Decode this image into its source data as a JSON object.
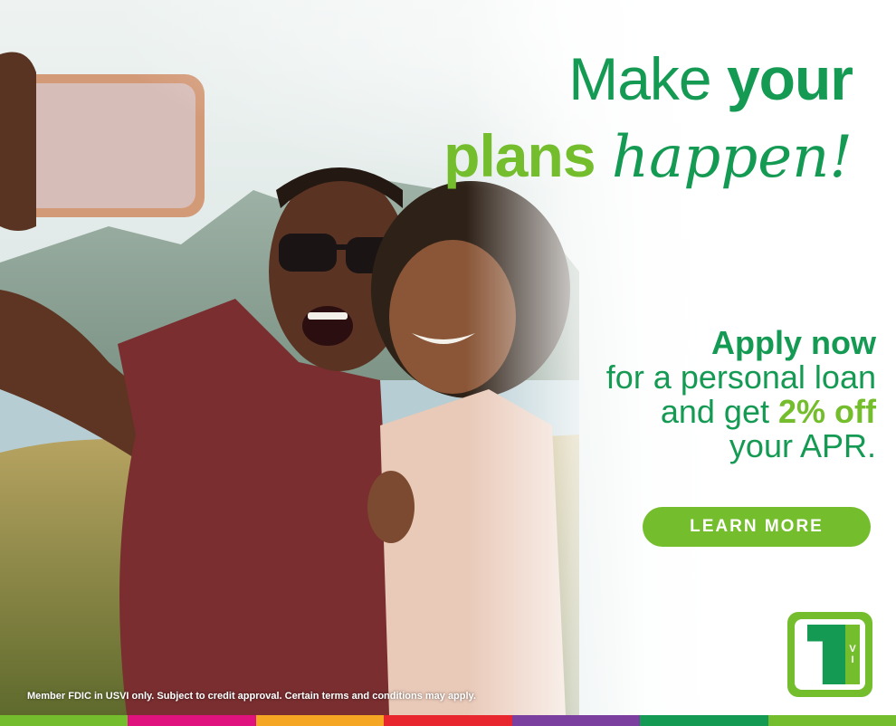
{
  "headline": {
    "make": "Make",
    "your": "your",
    "plans": "plans",
    "happen": "happen!"
  },
  "offer": {
    "apply": "Apply now",
    "line2": "for a personal loan",
    "line3_prefix": "and get",
    "discount": "2% off",
    "line4": "your APR."
  },
  "cta": {
    "label": "LEARN MORE"
  },
  "logo": {
    "number": "1",
    "letters": [
      "V",
      "I"
    ]
  },
  "disclaimer": "Member FDIC in USVI only.  Subject to credit approval. Certain terms and conditions may apply.",
  "colors": {
    "dark_green": "#159a54",
    "light_green": "#74bd2c",
    "stripe_colors": [
      "#74bd2c",
      "#e0127d",
      "#f5a623",
      "#e8262d",
      "#7b3fa0",
      "#159a54",
      "#74bd2c"
    ]
  }
}
